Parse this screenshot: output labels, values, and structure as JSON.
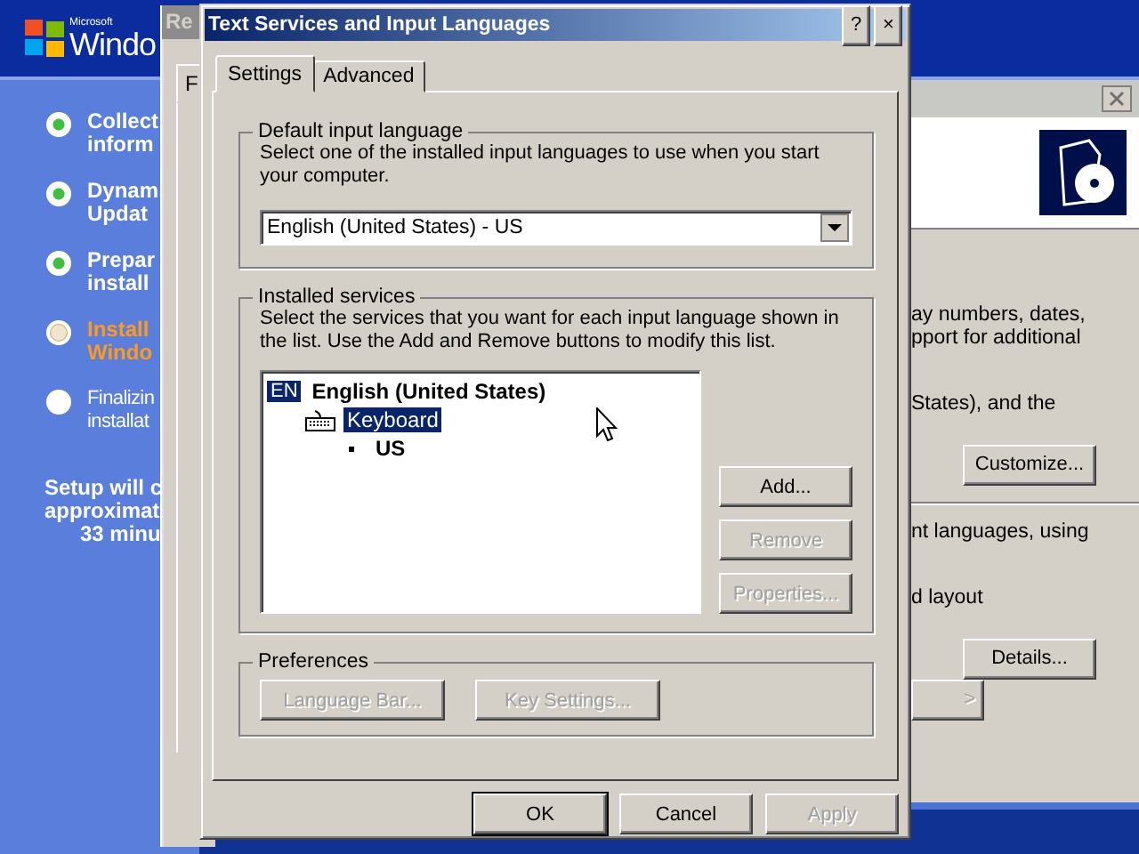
{
  "setup": {
    "logo_small": "Microsoft",
    "logo_text": "Windo",
    "steps": [
      {
        "lines": [
          "Collect",
          "inform"
        ],
        "completed": true,
        "current": false
      },
      {
        "lines": [
          "Dynam",
          "Updat"
        ],
        "completed": true,
        "current": false
      },
      {
        "lines": [
          "Prepar",
          "install"
        ],
        "completed": true,
        "current": false
      },
      {
        "lines": [
          "Install",
          "Windo"
        ],
        "completed": false,
        "current": true
      },
      {
        "lines": [
          "Finalizin",
          "installat"
        ],
        "completed": false,
        "current": false
      }
    ],
    "time_lines": [
      "Setup will c",
      "approximat",
      "33 minu"
    ]
  },
  "regional_window": {
    "title": "Re",
    "tab": "F"
  },
  "wizard_window": {
    "lines": [
      "ay numbers, dates,",
      "pport for additional",
      "States), and the"
    ],
    "customize_button": "Customize...",
    "lines_2": [
      "nt languages, using",
      "d layout"
    ],
    "details_button": "Details...",
    "nav_button": ">"
  },
  "dialog": {
    "title": "Text Services and Input Languages",
    "help_button": "?",
    "close_button": "×",
    "tabs": [
      {
        "label": "Settings",
        "selected": true
      },
      {
        "label": "Advanced",
        "selected": false
      }
    ],
    "default_group": {
      "title": "Default input language",
      "description": "Select one of the installed input languages to use when you start your computer.",
      "dropdown": {
        "value": "English (United States) - US"
      }
    },
    "services_group": {
      "title": "Installed services",
      "description": "Select the services that you want for each input language shown in the list. Use the Add and Remove buttons to modify this list.",
      "tree": [
        {
          "kind": "language",
          "badge": "EN",
          "label": "English (United States)",
          "selected": false,
          "children": [
            {
              "kind": "category",
              "label": "Keyboard",
              "selected": true,
              "children": [
                {
                  "kind": "layout",
                  "label": "US",
                  "selected": false
                }
              ]
            }
          ]
        }
      ],
      "buttons": [
        {
          "label": "Add...",
          "disabled": false
        },
        {
          "label": "Remove",
          "disabled": true
        },
        {
          "label": "Properties...",
          "disabled": true
        }
      ]
    },
    "preferences_group": {
      "title": "Preferences",
      "buttons": [
        {
          "label": "Language Bar...",
          "disabled": true
        },
        {
          "label": "Key Settings...",
          "disabled": true
        }
      ]
    },
    "buttons": [
      {
        "label": "OK",
        "disabled": false,
        "default": true
      },
      {
        "label": "Cancel",
        "disabled": false,
        "default": false
      },
      {
        "label": "Apply",
        "disabled": true,
        "default": false
      }
    ]
  }
}
